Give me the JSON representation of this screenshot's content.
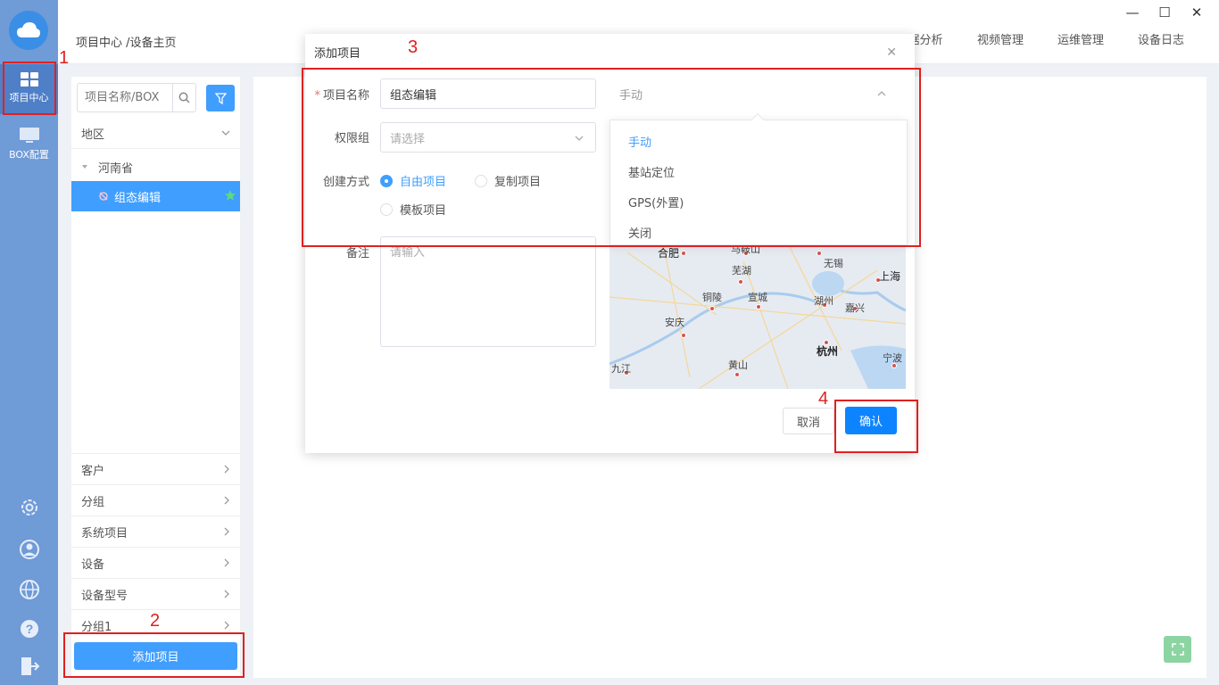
{
  "sidebar": {
    "items": [
      {
        "label": "项目中心",
        "icon": "grid-icon",
        "active": true
      },
      {
        "label": "BOX配置",
        "icon": "monitor-icon",
        "active": false
      }
    ],
    "bottom_icons": [
      "settings-icon",
      "user-icon",
      "globe-icon",
      "help-icon",
      "logout-icon"
    ]
  },
  "header": {
    "breadcrumb": "项目中心 /设备主页",
    "tabs": [
      "据分析",
      "视频管理",
      "运维管理",
      "设备日志"
    ]
  },
  "tree": {
    "search_placeholder": "项目名称/BOX",
    "region_label": "地区",
    "province": "河南省",
    "selected_node": "组态编辑",
    "groups": [
      "客户",
      "分组",
      "系统项目",
      "设备",
      "设备型号",
      "分组1"
    ],
    "add_button": "添加项目"
  },
  "dialog": {
    "title": "添加项目",
    "name_label": "项目名称",
    "name_value": "组态编辑",
    "location_mode_value": "手动",
    "permission_label": "权限组",
    "permission_placeholder": "请选择",
    "create_label": "创建方式",
    "create_options": [
      "自由项目",
      "复制项目",
      "模板项目"
    ],
    "create_selected": "自由项目",
    "remark_label": "备注",
    "remark_placeholder": "请输入",
    "cancel_label": "取消",
    "confirm_label": "确认",
    "location_options": [
      "手动",
      "基站定位",
      "GPS(外置)",
      "关闭"
    ],
    "map_cities": [
      "合肥",
      "马鞍山",
      "芜湖",
      "无锡",
      "上海",
      "铜陵",
      "宣城",
      "湖州",
      "嘉兴",
      "安庆",
      "杭州",
      "黄山",
      "宁波",
      "九江"
    ]
  },
  "annotations": [
    "1",
    "2",
    "3",
    "4"
  ],
  "colors": {
    "primary": "#409eff",
    "rail": "#6f9bd7",
    "annotation": "#e02020"
  }
}
